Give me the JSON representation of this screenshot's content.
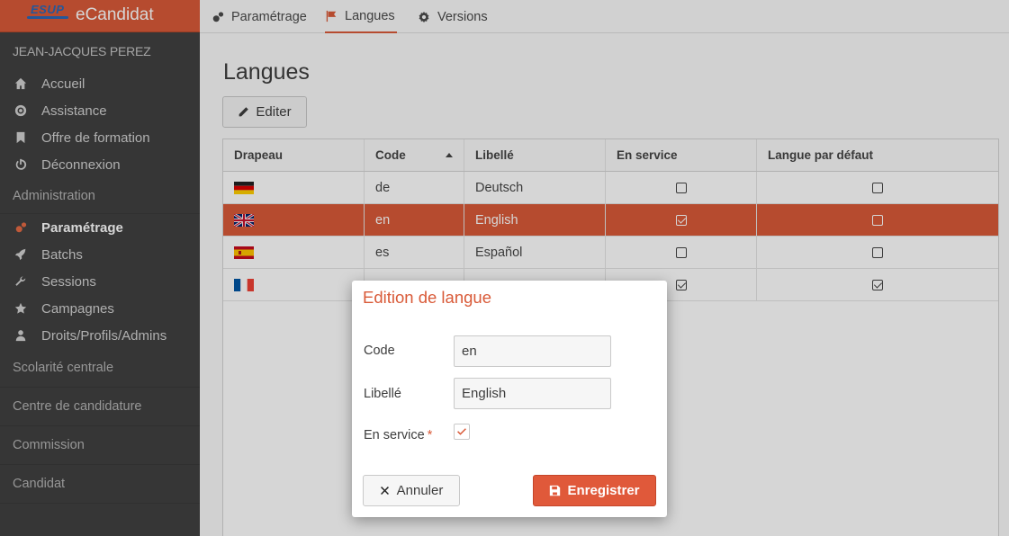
{
  "app": {
    "brand_logo": "ESUP",
    "brand_name": "eCandidat"
  },
  "sidebar": {
    "user": "JEAN-JACQUES PEREZ",
    "top_items": [
      {
        "label": "Accueil",
        "icon": "home-icon"
      },
      {
        "label": "Assistance",
        "icon": "lifebuoy-icon"
      },
      {
        "label": "Offre de formation",
        "icon": "bookmark-icon"
      },
      {
        "label": "Déconnexion",
        "icon": "power-icon"
      }
    ],
    "section_admin": "Administration",
    "admin_items": [
      {
        "label": "Paramétrage",
        "icon": "cogs-icon",
        "active": true
      },
      {
        "label": "Batchs",
        "icon": "rocket-icon"
      },
      {
        "label": "Sessions",
        "icon": "wrench-icon"
      },
      {
        "label": "Campagnes",
        "icon": "star-icon"
      },
      {
        "label": "Droits/Profils/Admins",
        "icon": "user-icon"
      }
    ],
    "sections": [
      "Scolarité centrale",
      "Centre de candidature",
      "Commission",
      "Candidat"
    ]
  },
  "tabs": [
    {
      "label": "Paramétrage",
      "icon": "cogs-icon"
    },
    {
      "label": "Langues",
      "icon": "flag-icon",
      "active": true
    },
    {
      "label": "Versions",
      "icon": "gear-icon"
    }
  ],
  "page": {
    "title": "Langues",
    "edit_label": "Editer"
  },
  "table": {
    "headers": [
      "Drapeau",
      "Code",
      "Libellé",
      "En service",
      "Langue par défaut"
    ],
    "sorted_column": "Code",
    "rows": [
      {
        "flag": "germany-flag-icon",
        "code": "de",
        "label": "Deutsch",
        "en_service": false,
        "defaut": false,
        "selected": false
      },
      {
        "flag": "uk-flag-icon",
        "code": "en",
        "label": "English",
        "en_service": true,
        "defaut": false,
        "selected": true
      },
      {
        "flag": "spain-flag-icon",
        "code": "es",
        "label": "Español",
        "en_service": false,
        "defaut": false,
        "selected": false
      },
      {
        "flag": "france-flag-icon",
        "code": "",
        "label": "",
        "en_service": true,
        "defaut": true,
        "selected": false
      }
    ]
  },
  "modal": {
    "title": "Edition de langue",
    "code_label": "Code",
    "code_value": "en",
    "libelle_label": "Libellé",
    "libelle_value": "English",
    "service_label": "En service",
    "required_mark": "*",
    "service_checked": true,
    "cancel_label": "Annuler",
    "save_label": "Enregistrer"
  },
  "colors": {
    "accent": "#d95a38",
    "sidebar_bg": "#414141"
  }
}
